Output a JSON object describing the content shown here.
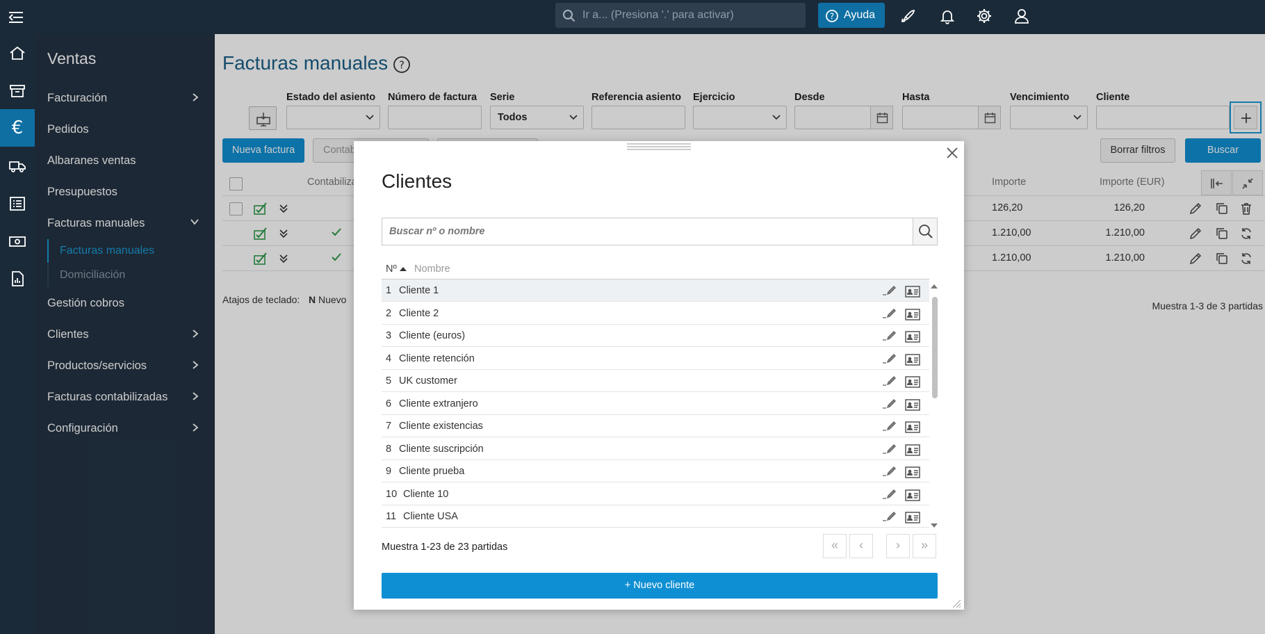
{
  "topbar": {
    "search_placeholder": "Ir a... (Presiona '.' para activar)",
    "help_label": "Ayuda"
  },
  "sidebar": {
    "title": "Ventas",
    "items": [
      {
        "label": "Facturación",
        "chevron": "right"
      },
      {
        "label": "Pedidos"
      },
      {
        "label": "Albaranes ventas"
      },
      {
        "label": "Presupuestos"
      },
      {
        "label": "Facturas manuales",
        "chevron": "down"
      },
      {
        "label": "Gestión cobros"
      },
      {
        "label": "Clientes",
        "chevron": "right"
      },
      {
        "label": "Productos/servicios",
        "chevron": "right"
      },
      {
        "label": "Facturas contabilizadas",
        "chevron": "right"
      },
      {
        "label": "Configuración",
        "chevron": "right"
      }
    ],
    "subitems": [
      {
        "label": "Facturas manuales",
        "active": true
      },
      {
        "label": "Domiciliación",
        "active": false
      }
    ]
  },
  "page": {
    "title": "Facturas manuales",
    "filters": {
      "estado_label": "Estado del asiento",
      "numero_label": "Número de factura",
      "serie_label": "Serie",
      "serie_value": "Todos",
      "referencia_label": "Referencia asiento",
      "ejercicio_label": "Ejercicio",
      "desde_label": "Desde",
      "hasta_label": "Hasta",
      "vencimiento_label": "Vencimiento",
      "cliente_label": "Cliente"
    },
    "buttons": {
      "new_invoice": "Nueva factura",
      "contab_partial": "Contab",
      "clear_filters": "Borrar filtros",
      "search": "Buscar"
    },
    "table": {
      "headers": {
        "contabilizada": "Contabiliza",
        "importe": "Importe",
        "importe_eur": "Importe (EUR)"
      },
      "rows": [
        {
          "importe": "126,20",
          "importe_eur": "126,20",
          "checked": false,
          "trailing_icon": "trash-icon"
        },
        {
          "importe": "1.210,00",
          "importe_eur": "1.210,00",
          "checked": true,
          "trailing_icon": "refresh-icon"
        },
        {
          "importe": "1.210,00",
          "importe_eur": "1.210,00",
          "checked": true,
          "trailing_icon": "refresh-icon"
        }
      ]
    },
    "shortcuts_label": "Atajos de teclado:",
    "shortcut_key": "N",
    "shortcut_action": "Nuevo",
    "count": "Muestra 1-3 de 3 partidas"
  },
  "modal": {
    "title": "Clientes",
    "search_placeholder": "Buscar nº o nombre",
    "col_no": "Nº",
    "col_name": "Nombre",
    "rows": [
      {
        "no": "1",
        "name": "Cliente 1"
      },
      {
        "no": "2",
        "name": "Cliente 2"
      },
      {
        "no": "3",
        "name": "Cliente (euros)"
      },
      {
        "no": "4",
        "name": "Cliente retención"
      },
      {
        "no": "5",
        "name": "UK customer"
      },
      {
        "no": "6",
        "name": "Cliente extranjero"
      },
      {
        "no": "7",
        "name": "Cliente existencias"
      },
      {
        "no": "8",
        "name": "Cliente suscripción"
      },
      {
        "no": "9",
        "name": "Cliente prueba"
      },
      {
        "no": "10",
        "name": "Cliente 10"
      },
      {
        "no": "11",
        "name": "Cliente USA"
      }
    ],
    "count": "Muestra 1-23 de 23 partidas",
    "pager": {
      "first": "«",
      "prev": "‹",
      "next": "›",
      "last": "»"
    },
    "new_client": "+ Nuevo cliente"
  },
  "colors": {
    "topbar": "#1b2a38",
    "sidebar": "#233343",
    "accent": "#0f8fd3",
    "title": "#1a5f87",
    "check": "#2e9a48"
  }
}
